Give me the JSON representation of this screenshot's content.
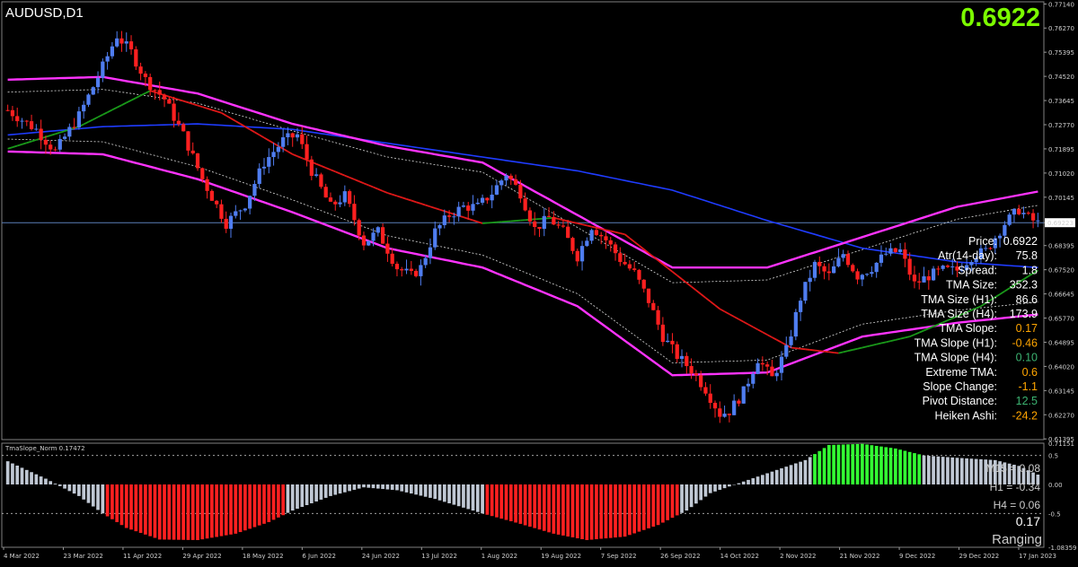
{
  "header": {
    "symbol_label": "AUDUSD,D1",
    "big_price": "0.6922",
    "big_price_color": "#7cfc00"
  },
  "price_tag": "0.69223",
  "info_panel": [
    {
      "label": "Price:",
      "value": "0.6922",
      "color": "#ffffff"
    },
    {
      "label": "Atr(14-day):",
      "value": "75.8",
      "color": "#ffffff"
    },
    {
      "label": "Spread:",
      "value": "1.8",
      "color": "#ffffff"
    },
    {
      "label": "TMA Size:",
      "value": "352.3",
      "color": "#ffffff"
    },
    {
      "label": "TMA Size (H1):",
      "value": "86.6",
      "color": "#ffffff"
    },
    {
      "label": "TMA Size (H4):",
      "value": "173.9",
      "color": "#ffffff"
    },
    {
      "label": "TMA Slope:",
      "value": "0.17",
      "color": "#ffa500"
    },
    {
      "label": "TMA Slope (H1):",
      "value": "-0.46",
      "color": "#ffa500"
    },
    {
      "label": "TMA Slope (H4):",
      "value": "0.10",
      "color": "#3cb371"
    },
    {
      "label": "Extreme TMA:",
      "value": "0.6",
      "color": "#ffa500"
    },
    {
      "label": "Slope Change:",
      "value": "-1.1",
      "color": "#ffa500"
    },
    {
      "label": "Pivot Distance:",
      "value": "12.5",
      "color": "#3cb371"
    },
    {
      "label": "Heiken Ashi:",
      "value": "-24.2",
      "color": "#ffa500"
    }
  ],
  "sub_panel": {
    "title": "TmaSlope_Norm 0.17472",
    "m15": "M15 = 0.08",
    "h1": "H1 = -0.34",
    "h4": "H4 = 0.06",
    "value": "0.17",
    "state": "Ranging"
  },
  "colors": {
    "bull": "#4f7df0",
    "bear": "#ff2020",
    "band_outer": "#ff33ff",
    "ma_blue": "#1f3cff",
    "hist_red": "#ff2020",
    "hist_green": "#33ff33",
    "hist_grey": "#c0c8d4",
    "panel_divider": "#8a8a8a"
  },
  "chart_data": [
    {
      "type": "candlestick",
      "symbol": "AUDUSD",
      "timeframe": "D1",
      "y_ticks": [
        "0.77140",
        "0.76270",
        "0.75395",
        "0.74520",
        "0.73645",
        "0.72770",
        "0.71895",
        "0.71020",
        "0.70145",
        "0.69223",
        "0.68395",
        "0.67520",
        "0.66645",
        "0.65770",
        "0.64895",
        "0.64020",
        "0.63145",
        "0.62270",
        "0.61395"
      ],
      "ylim": [
        0.6137,
        0.7722
      ],
      "x_ticks": [
        "4 Mar 2022",
        "23 Mar 2022",
        "11 Apr 2022",
        "29 Apr 2022",
        "18 May 2022",
        "6 Jun 2022",
        "24 Jun 2022",
        "13 Jul 2022",
        "1 Aug 2022",
        "19 Aug 2022",
        "7 Sep 2022",
        "26 Sep 2022",
        "14 Oct 2022",
        "2 Nov 2022",
        "21 Nov 2022",
        "9 Dec 2022",
        "29 Dec 2022",
        "17 Jan 2023"
      ],
      "current_price": 0.6922,
      "close_path": [
        [
          0,
          0.733
        ],
        [
          6,
          0.726
        ],
        [
          10,
          0.718
        ],
        [
          15,
          0.731
        ],
        [
          19,
          0.745
        ],
        [
          23,
          0.76
        ],
        [
          26,
          0.754
        ],
        [
          29,
          0.744
        ],
        [
          33,
          0.737
        ],
        [
          37,
          0.724
        ],
        [
          41,
          0.708
        ],
        [
          46,
          0.692
        ],
        [
          50,
          0.699
        ],
        [
          54,
          0.714
        ],
        [
          58,
          0.722
        ],
        [
          61,
          0.724
        ],
        [
          64,
          0.711
        ],
        [
          68,
          0.698
        ],
        [
          71,
          0.702
        ],
        [
          75,
          0.685
        ],
        [
          78,
          0.689
        ],
        [
          82,
          0.676
        ],
        [
          85,
          0.673
        ],
        [
          87,
          0.676
        ],
        [
          90,
          0.689
        ],
        [
          93,
          0.695
        ],
        [
          96,
          0.698
        ],
        [
          99,
          0.698
        ],
        [
          102,
          0.703
        ],
        [
          105,
          0.71
        ],
        [
          108,
          0.703
        ],
        [
          111,
          0.69
        ],
        [
          114,
          0.694
        ],
        [
          117,
          0.689
        ],
        [
          120,
          0.68
        ],
        [
          123,
          0.691
        ],
        [
          126,
          0.686
        ],
        [
          129,
          0.679
        ],
        [
          132,
          0.674
        ],
        [
          135,
          0.664
        ],
        [
          138,
          0.651
        ],
        [
          141,
          0.644
        ],
        [
          144,
          0.639
        ],
        [
          147,
          0.632
        ],
        [
          150,
          0.623
        ],
        [
          152,
          0.624
        ],
        [
          155,
          0.631
        ],
        [
          158,
          0.643
        ],
        [
          161,
          0.636
        ],
        [
          164,
          0.646
        ],
        [
          167,
          0.665
        ],
        [
          170,
          0.677
        ],
        [
          173,
          0.673
        ],
        [
          176,
          0.681
        ],
        [
          179,
          0.673
        ],
        [
          182,
          0.676
        ],
        [
          185,
          0.681
        ],
        [
          188,
          0.682
        ],
        [
          191,
          0.67
        ],
        [
          194,
          0.673
        ],
        [
          197,
          0.675
        ],
        [
          200,
          0.675
        ],
        [
          203,
          0.68
        ],
        [
          206,
          0.682
        ],
        [
          210,
          0.692
        ],
        [
          213,
          0.697
        ],
        [
          215,
          0.694
        ],
        [
          217,
          0.692
        ]
      ],
      "n_bars": 218,
      "band_upper": [
        [
          0,
          0.744
        ],
        [
          20,
          0.745
        ],
        [
          40,
          0.739
        ],
        [
          60,
          0.728
        ],
        [
          80,
          0.72
        ],
        [
          100,
          0.714
        ],
        [
          120,
          0.695
        ],
        [
          140,
          0.676
        ],
        [
          160,
          0.676
        ],
        [
          180,
          0.687
        ],
        [
          200,
          0.698
        ],
        [
          217,
          0.7035
        ]
      ],
      "band_lower": [
        [
          0,
          0.718
        ],
        [
          20,
          0.717
        ],
        [
          40,
          0.708
        ],
        [
          60,
          0.696
        ],
        [
          80,
          0.683
        ],
        [
          100,
          0.676
        ],
        [
          120,
          0.662
        ],
        [
          140,
          0.637
        ],
        [
          160,
          0.638
        ],
        [
          180,
          0.651
        ],
        [
          200,
          0.656
        ],
        [
          217,
          0.659
        ]
      ],
      "band_inner_upper": [
        [
          0,
          0.7395
        ],
        [
          20,
          0.7405
        ],
        [
          40,
          0.7355
        ],
        [
          60,
          0.7255
        ],
        [
          80,
          0.716
        ],
        [
          100,
          0.7105
        ],
        [
          120,
          0.6905
        ],
        [
          140,
          0.6705
        ],
        [
          160,
          0.6715
        ],
        [
          180,
          0.6825
        ],
        [
          200,
          0.6935
        ],
        [
          217,
          0.6985
        ]
      ],
      "band_inner_lower": [
        [
          0,
          0.7225
        ],
        [
          20,
          0.7215
        ],
        [
          40,
          0.7125
        ],
        [
          60,
          0.7005
        ],
        [
          80,
          0.6875
        ],
        [
          100,
          0.6805
        ],
        [
          120,
          0.6665
        ],
        [
          140,
          0.6415
        ],
        [
          160,
          0.6425
        ],
        [
          180,
          0.6555
        ],
        [
          200,
          0.6605
        ],
        [
          217,
          0.6635
        ]
      ],
      "ma_fast": [
        [
          0,
          0.719
        ],
        [
          15,
          0.727
        ],
        [
          30,
          0.74
        ],
        [
          45,
          0.732
        ],
        [
          60,
          0.717
        ],
        [
          80,
          0.703
        ],
        [
          100,
          0.692
        ],
        [
          115,
          0.694
        ],
        [
          130,
          0.688
        ],
        [
          150,
          0.661
        ],
        [
          165,
          0.647
        ],
        [
          175,
          0.645
        ],
        [
          190,
          0.651
        ],
        [
          205,
          0.662
        ],
        [
          217,
          0.675
        ]
      ],
      "ma_slow": [
        [
          0,
          0.724
        ],
        [
          20,
          0.727
        ],
        [
          40,
          0.728
        ],
        [
          60,
          0.726
        ],
        [
          80,
          0.721
        ],
        [
          100,
          0.716
        ],
        [
          120,
          0.711
        ],
        [
          140,
          0.704
        ],
        [
          160,
          0.693
        ],
        [
          180,
          0.683
        ],
        [
          200,
          0.678
        ],
        [
          217,
          0.676
        ]
      ],
      "sub_indicator": {
        "name": "TmaSlope_Norm",
        "y_ticks": [
          "0.71151",
          "0.5",
          "0.00",
          "-0.5",
          "-1.08359"
        ],
        "ylim": [
          -1.08359,
          0.71151
        ],
        "values_path": [
          [
            0,
            0.4
          ],
          [
            8,
            0.1
          ],
          [
            15,
            -0.2
          ],
          [
            20,
            -0.5
          ],
          [
            25,
            -0.75
          ],
          [
            32,
            -0.95
          ],
          [
            40,
            -0.96
          ],
          [
            48,
            -0.85
          ],
          [
            55,
            -0.65
          ],
          [
            60,
            -0.45
          ],
          [
            68,
            -0.2
          ],
          [
            75,
            -0.05
          ],
          [
            82,
            -0.1
          ],
          [
            90,
            -0.25
          ],
          [
            100,
            -0.5
          ],
          [
            108,
            -0.68
          ],
          [
            115,
            -0.85
          ],
          [
            122,
            -0.96
          ],
          [
            130,
            -0.9
          ],
          [
            137,
            -0.7
          ],
          [
            143,
            -0.45
          ],
          [
            148,
            -0.15
          ],
          [
            155,
            0.05
          ],
          [
            162,
            0.25
          ],
          [
            168,
            0.42
          ],
          [
            173,
            0.68
          ],
          [
            180,
            0.7
          ],
          [
            187,
            0.62
          ],
          [
            193,
            0.5
          ],
          [
            200,
            0.46
          ],
          [
            208,
            0.42
          ],
          [
            213,
            0.32
          ],
          [
            217,
            0.17
          ]
        ]
      }
    }
  ]
}
